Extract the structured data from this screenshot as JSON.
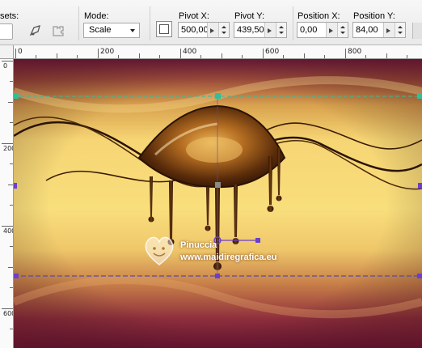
{
  "toolbar": {
    "presets_label": "sets:",
    "mode_label": "Mode:",
    "mode_value": "Scale",
    "pivot_x_label": "Pivot X:",
    "pivot_x_value": "500,00",
    "pivot_y_label": "Pivot Y:",
    "pivot_y_value": "439,50",
    "position_x_label": "Position X:",
    "position_x_value": "0,00",
    "position_y_label": "Position Y:",
    "position_y_value": "84,00"
  },
  "ruler": {
    "h_labels": [
      "0",
      "200",
      "400",
      "600",
      "800"
    ],
    "v_labels": [
      "0",
      "200",
      "400",
      "600"
    ]
  },
  "watermark": {
    "line1": "Pinuccia",
    "line2": "www.maidiregrafica.eu"
  },
  "colors": {
    "handle_teal": "#2fbf9a",
    "handle_purple": "#6a3fd0",
    "guide_line": "#5a4ab0",
    "bg_gold": "#f4d77a",
    "bg_wine": "#7a1e3c"
  }
}
